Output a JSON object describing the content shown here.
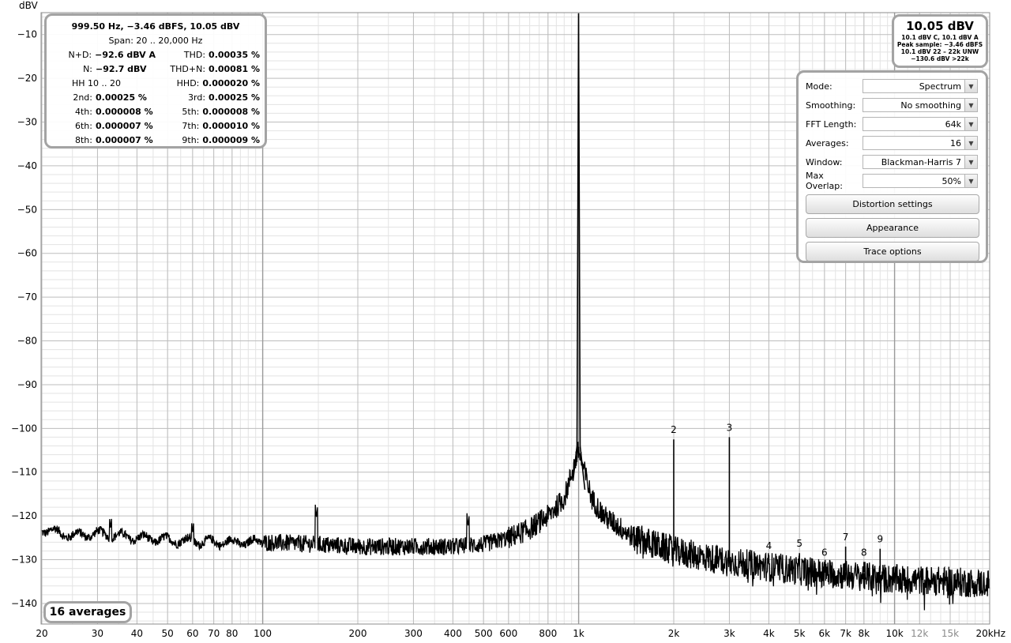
{
  "chart_data": {
    "type": "line",
    "ylabel": "dBV",
    "xscale": "log",
    "xlim": [
      20,
      20000
    ],
    "ylim": [
      -140,
      -10
    ],
    "grid": true,
    "y_ticks": [
      -10,
      -20,
      -30,
      -40,
      -50,
      -60,
      -70,
      -80,
      -90,
      -100,
      -110,
      -120,
      -130,
      -140
    ],
    "x_ticks": [
      {
        "v": 20,
        "label": "20"
      },
      {
        "v": 30,
        "label": "30"
      },
      {
        "v": 40,
        "label": "40"
      },
      {
        "v": 50,
        "label": "50"
      },
      {
        "v": 60,
        "label": "60"
      },
      {
        "v": 70,
        "label": "70"
      },
      {
        "v": 80,
        "label": "80"
      },
      {
        "v": 100,
        "label": "100"
      },
      {
        "v": 200,
        "label": "200"
      },
      {
        "v": 300,
        "label": "300"
      },
      {
        "v": 400,
        "label": "400"
      },
      {
        "v": 500,
        "label": "500"
      },
      {
        "v": 600,
        "label": "600"
      },
      {
        "v": 800,
        "label": "800"
      },
      {
        "v": 1000,
        "label": "1k"
      },
      {
        "v": 2000,
        "label": "2k"
      },
      {
        "v": 3000,
        "label": "3k"
      },
      {
        "v": 4000,
        "label": "4k"
      },
      {
        "v": 5000,
        "label": "5k"
      },
      {
        "v": 6000,
        "label": "6k"
      },
      {
        "v": 7000,
        "label": "7k"
      },
      {
        "v": 8000,
        "label": "8k"
      },
      {
        "v": 10000,
        "label": "10k"
      },
      {
        "v": 12000,
        "label": "12k",
        "muted": true
      },
      {
        "v": 15000,
        "label": "15k",
        "muted": true
      },
      {
        "v": 20000,
        "label": "20kHz"
      }
    ],
    "fundamental": {
      "freq": 999.5,
      "level": 10.05
    },
    "harmonics": [
      {
        "label": "2",
        "freq": 2000,
        "level": -102.5
      },
      {
        "label": "3",
        "freq": 3000,
        "level": -102.0
      },
      {
        "label": "4",
        "freq": 4000,
        "level": -129.0
      },
      {
        "label": "5",
        "freq": 5000,
        "level": -128.5
      },
      {
        "label": "6",
        "freq": 6000,
        "level": -130.5
      },
      {
        "label": "7",
        "freq": 7000,
        "level": -127.0
      },
      {
        "label": "8",
        "freq": 8000,
        "level": -130.5
      },
      {
        "label": "9",
        "freq": 9000,
        "level": -127.5
      }
    ],
    "noise_floor": [
      {
        "f": 20,
        "db": -123
      },
      {
        "f": 25,
        "db": -124.5
      },
      {
        "f": 30,
        "db": -124
      },
      {
        "f": 40,
        "db": -125
      },
      {
        "f": 50,
        "db": -125.5
      },
      {
        "f": 70,
        "db": -126
      },
      {
        "f": 100,
        "db": -126
      },
      {
        "f": 150,
        "db": -126.5
      },
      {
        "f": 200,
        "db": -127
      },
      {
        "f": 300,
        "db": -127
      },
      {
        "f": 400,
        "db": -127
      },
      {
        "f": 500,
        "db": -126.5
      },
      {
        "f": 600,
        "db": -125
      },
      {
        "f": 700,
        "db": -123
      },
      {
        "f": 800,
        "db": -120
      },
      {
        "f": 900,
        "db": -116
      },
      {
        "f": 1000,
        "db": -105
      },
      {
        "f": 1100,
        "db": -116
      },
      {
        "f": 1200,
        "db": -120
      },
      {
        "f": 1500,
        "db": -125
      },
      {
        "f": 2000,
        "db": -128
      },
      {
        "f": 3000,
        "db": -130.5
      },
      {
        "f": 5000,
        "db": -132.5
      },
      {
        "f": 7000,
        "db": -133.5
      },
      {
        "f": 10000,
        "db": -134.5
      },
      {
        "f": 15000,
        "db": -135
      },
      {
        "f": 20000,
        "db": -135.5
      }
    ],
    "spurs": [
      {
        "f": 148,
        "db": -120.5
      },
      {
        "f": 447,
        "db": -122.5
      },
      {
        "f": 33,
        "db": -123
      },
      {
        "f": 60,
        "db": -124
      }
    ],
    "trace_color": "#000000",
    "grid_major_color": "#bdbdbd",
    "grid_minor_color": "#e3e3e3"
  },
  "readout": {
    "header": "999.50 Hz, −3.46 dBFS, 10.05 dBV",
    "span": "Span: 20 .. 20,000 Hz",
    "rows": [
      {
        "l_label": "N+D:",
        "l_value": "−92.6 dBV A",
        "r_label": "THD:",
        "r_value": "0.00035 %"
      },
      {
        "l_label": "N:",
        "l_value": "−92.7 dBV",
        "r_label": "THD+N:",
        "r_value": "0.00081 %"
      },
      {
        "l_label": "HH 10 .. 20",
        "l_value": "",
        "r_label": "HHD:",
        "r_value": "0.000020 %"
      },
      {
        "l_label": "2nd:",
        "l_value": "0.00025 %",
        "r_label": "3rd:",
        "r_value": "0.00025 %"
      },
      {
        "l_label": "4th:",
        "l_value": "0.000008 %",
        "r_label": "5th:",
        "r_value": "0.000008 %"
      },
      {
        "l_label": "6th:",
        "l_value": "0.000007 %",
        "r_label": "7th:",
        "r_value": "0.000010 %"
      },
      {
        "l_label": "8th:",
        "l_value": "0.000007 %",
        "r_label": "9th:",
        "r_value": "0.000009 %"
      }
    ]
  },
  "level": {
    "main": "10.05 dBV",
    "line1": "10.1 dBV C, 10.1 dBV A",
    "line2": "Peak sample: −3.46 dBFS",
    "line3": "10.1 dBV 22 – 22k UNW",
    "line4": "−130.6 dBV >22k"
  },
  "controls": {
    "mode": {
      "label": "Mode:",
      "value": "Spectrum"
    },
    "smoothing": {
      "label": "Smoothing:",
      "value": "No  smoothing"
    },
    "fft": {
      "label": "FFT Length:",
      "value": "64k"
    },
    "averages": {
      "label": "Averages:",
      "value": "16"
    },
    "window": {
      "label": "Window:",
      "value": "Blackman-Harris 7"
    },
    "overlap": {
      "label": "Max Overlap:",
      "value": "50%"
    },
    "distortion_button": "Distortion settings",
    "appearance_button": "Appearance",
    "trace_button": "Trace options"
  },
  "averages_badge": "16 averages"
}
